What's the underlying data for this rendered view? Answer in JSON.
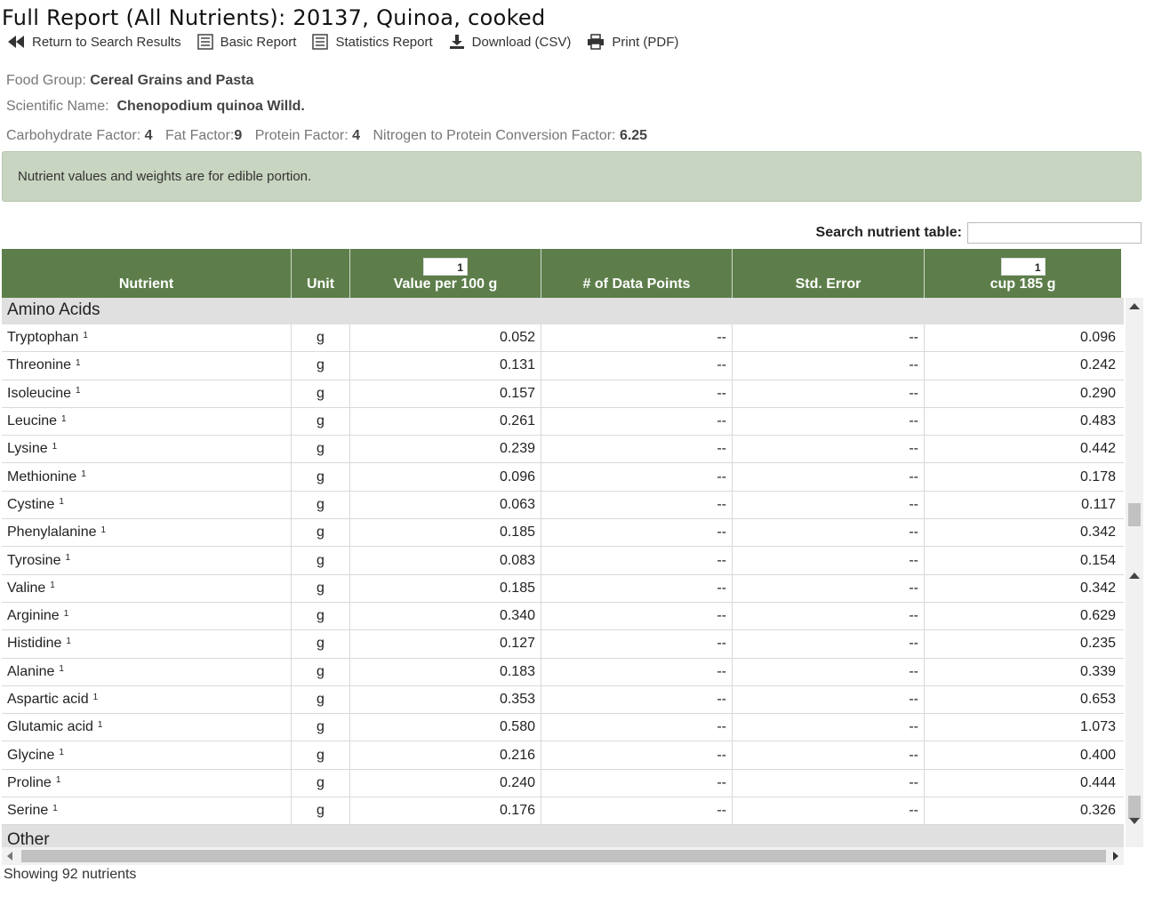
{
  "header": {
    "title": "Full Report (All Nutrients):  20137, Quinoa, cooked"
  },
  "toolbar": {
    "return_label": "Return to Search Results",
    "basic_label": "Basic Report",
    "stats_label": "Statistics Report",
    "download_label": "Download (CSV)",
    "print_label": "Print (PDF)"
  },
  "food": {
    "group_label": "Food Group:",
    "group_value": "Cereal Grains and Pasta",
    "sci_label": "Scientific Name:",
    "sci_value": "Chenopodium quinoa Willd.",
    "carb_label": "Carbohydrate Factor:",
    "carb_value": "4",
    "fat_label": "Fat Factor:",
    "fat_value": "9",
    "protein_label": "Protein Factor:",
    "protein_value": "4",
    "nitrogen_label": "Nitrogen to Protein Conversion Factor:",
    "nitrogen_value": "6.25"
  },
  "notice": "Nutrient values and weights are for edible portion.",
  "search": {
    "label": "Search nutrient table:",
    "value": ""
  },
  "table": {
    "headers": {
      "nutrient": "Nutrient",
      "unit": "Unit",
      "value_mult": "1",
      "value": "Value per 100 g",
      "datapoints": "# of Data Points",
      "stderr": "Std. Error",
      "cup_mult": "1",
      "cup": "cup 185 g"
    },
    "group1": "Amino Acids",
    "group2": "Other",
    "rows": [
      {
        "name": "Tryptophan",
        "fn": "1",
        "unit": "g",
        "value": "0.052",
        "dp": "--",
        "se": "--",
        "cup": "0.096"
      },
      {
        "name": "Threonine",
        "fn": "1",
        "unit": "g",
        "value": "0.131",
        "dp": "--",
        "se": "--",
        "cup": "0.242"
      },
      {
        "name": "Isoleucine",
        "fn": "1",
        "unit": "g",
        "value": "0.157",
        "dp": "--",
        "se": "--",
        "cup": "0.290"
      },
      {
        "name": "Leucine",
        "fn": "1",
        "unit": "g",
        "value": "0.261",
        "dp": "--",
        "se": "--",
        "cup": "0.483"
      },
      {
        "name": "Lysine",
        "fn": "1",
        "unit": "g",
        "value": "0.239",
        "dp": "--",
        "se": "--",
        "cup": "0.442"
      },
      {
        "name": "Methionine",
        "fn": "1",
        "unit": "g",
        "value": "0.096",
        "dp": "--",
        "se": "--",
        "cup": "0.178"
      },
      {
        "name": "Cystine",
        "fn": "1",
        "unit": "g",
        "value": "0.063",
        "dp": "--",
        "se": "--",
        "cup": "0.117"
      },
      {
        "name": "Phenylalanine",
        "fn": "1",
        "unit": "g",
        "value": "0.185",
        "dp": "--",
        "se": "--",
        "cup": "0.342"
      },
      {
        "name": "Tyrosine",
        "fn": "1",
        "unit": "g",
        "value": "0.083",
        "dp": "--",
        "se": "--",
        "cup": "0.154"
      },
      {
        "name": "Valine",
        "fn": "1",
        "unit": "g",
        "value": "0.185",
        "dp": "--",
        "se": "--",
        "cup": "0.342"
      },
      {
        "name": "Arginine",
        "fn": "1",
        "unit": "g",
        "value": "0.340",
        "dp": "--",
        "se": "--",
        "cup": "0.629"
      },
      {
        "name": "Histidine",
        "fn": "1",
        "unit": "g",
        "value": "0.127",
        "dp": "--",
        "se": "--",
        "cup": "0.235"
      },
      {
        "name": "Alanine",
        "fn": "1",
        "unit": "g",
        "value": "0.183",
        "dp": "--",
        "se": "--",
        "cup": "0.339"
      },
      {
        "name": "Aspartic acid",
        "fn": "1",
        "unit": "g",
        "value": "0.353",
        "dp": "--",
        "se": "--",
        "cup": "0.653"
      },
      {
        "name": "Glutamic acid",
        "fn": "1",
        "unit": "g",
        "value": "0.580",
        "dp": "--",
        "se": "--",
        "cup": "1.073"
      },
      {
        "name": "Glycine",
        "fn": "1",
        "unit": "g",
        "value": "0.216",
        "dp": "--",
        "se": "--",
        "cup": "0.400"
      },
      {
        "name": "Proline",
        "fn": "1",
        "unit": "g",
        "value": "0.240",
        "dp": "--",
        "se": "--",
        "cup": "0.444"
      },
      {
        "name": "Serine",
        "fn": "1",
        "unit": "g",
        "value": "0.176",
        "dp": "--",
        "se": "--",
        "cup": "0.326"
      }
    ]
  },
  "footer": "Showing 92 nutrients",
  "colors": {
    "header_bg": "#5d7e4a",
    "notice_bg": "#c8d5c0",
    "group_bg": "#e0e0e0"
  },
  "icons": {
    "return": "rewind-icon",
    "basic": "list-icon",
    "stats": "list-icon",
    "download": "download-icon",
    "print": "printer-icon"
  }
}
